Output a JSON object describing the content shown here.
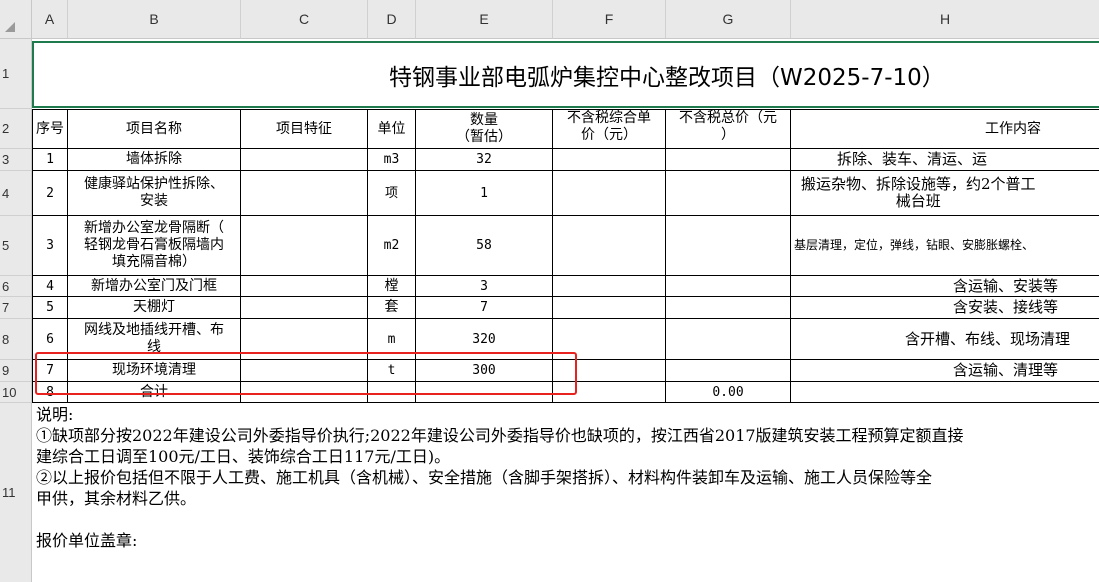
{
  "columns": [
    "A",
    "B",
    "C",
    "D",
    "E",
    "F",
    "G",
    "H"
  ],
  "rows": [
    "1",
    "2",
    "3",
    "4",
    "5",
    "6",
    "7",
    "8",
    "9",
    "10",
    "11"
  ],
  "title": "特钢事业部电弧炉集控中心整改项目（W2025-7-10）",
  "headers": {
    "seq": "序号",
    "name": "项目名称",
    "feature": "项目特征",
    "unit": "单位",
    "qty": "数量\n（暂估）",
    "unit_price": "不含税综合单\n价（元）",
    "total_price": "不含税总价（元\n）",
    "work": "工作内容"
  },
  "items": [
    {
      "seq": "1",
      "name": "墙体拆除",
      "unit": "m3",
      "qty": "32",
      "total": "",
      "work": "拆除、装车、清运、运"
    },
    {
      "seq": "2",
      "name": "健康驿站保护性拆除、\n安装",
      "unit": "项",
      "qty": "1",
      "total": "",
      "work": "搬运杂物、拆除设施等，约2个普工\n械台班"
    },
    {
      "seq": "3",
      "name": "新增办公室龙骨隔断（\n轻钢龙骨石膏板隔墙内\n填充隔音棉）",
      "unit": "m2",
      "qty": "58",
      "total": "",
      "work": "基层清理，定位，弹线，钻眼、安膨胀螺栓、"
    },
    {
      "seq": "4",
      "name": "新增办公室门及门框",
      "unit": "樘",
      "qty": "3",
      "total": "",
      "work": "含运输、安装等"
    },
    {
      "seq": "5",
      "name": "天棚灯",
      "unit": "套",
      "qty": "7",
      "total": "",
      "work": "含安装、接线等"
    },
    {
      "seq": "6",
      "name": "网线及地插线开槽、布\n线",
      "unit": "m",
      "qty": "320",
      "total": "",
      "work": "含开槽、布线、现场清理"
    },
    {
      "seq": "7",
      "name": "现场环境清理",
      "unit": "t",
      "qty": "300",
      "total": "",
      "work": "含运输、清理等"
    },
    {
      "seq": "8",
      "name": "合计",
      "unit": "",
      "qty": "",
      "total": "0.00",
      "work": ""
    }
  ],
  "notes": "说明:\n①缺项部分按2022年建设公司外委指导价执行;2022年建设公司外委指导价也缺项的，按江西省2017版建筑安装工程预算定额直接\n建综合工日调至100元/工日、装饰综合工日117元/工日)。\n②以上报价包括但不限于人工费、施工机具（含机械）、安全措施（含脚手架搭拆）、材料构件装卸车及运输、施工人员保险等全\n甲供，其余材料乙供。\n\n报价单位盖章:"
}
